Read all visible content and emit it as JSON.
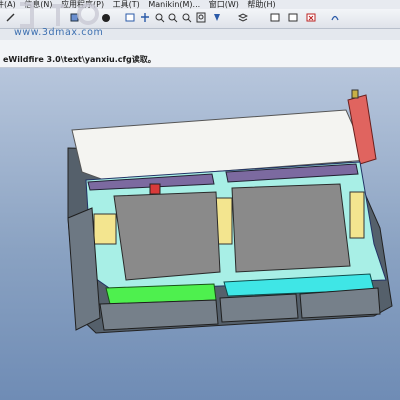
{
  "menubar": {
    "items": [
      "件(A)",
      "信息(N)",
      "应用程序(P)",
      "工具(T)",
      "Manikin(M)...",
      "窗口(W)",
      "帮助(H)"
    ]
  },
  "watermark": {
    "url": "www.3dmax.com"
  },
  "message_area": {
    "text": "eWildfire 3.0\\text\\yanxiu.cfg读取。"
  },
  "toolbar": {
    "icons": [
      "sketch-icon",
      "cube-icon",
      "sphere-icon",
      "view-icon",
      "pan-icon",
      "zoom-in-icon",
      "zoom-out-icon",
      "refit-icon",
      "orient-icon",
      "saved-views-icon",
      "layers-icon",
      "window-icon",
      "close-window-icon"
    ]
  },
  "colors": {
    "background_top": "#b7c6dc",
    "background_bottom": "#6f8cb5",
    "panel_gray": "#8a8a8a",
    "frame_cyan": "#a8efe6",
    "cover_white": "#f4f4f1",
    "handle_red": "#e0645f"
  }
}
